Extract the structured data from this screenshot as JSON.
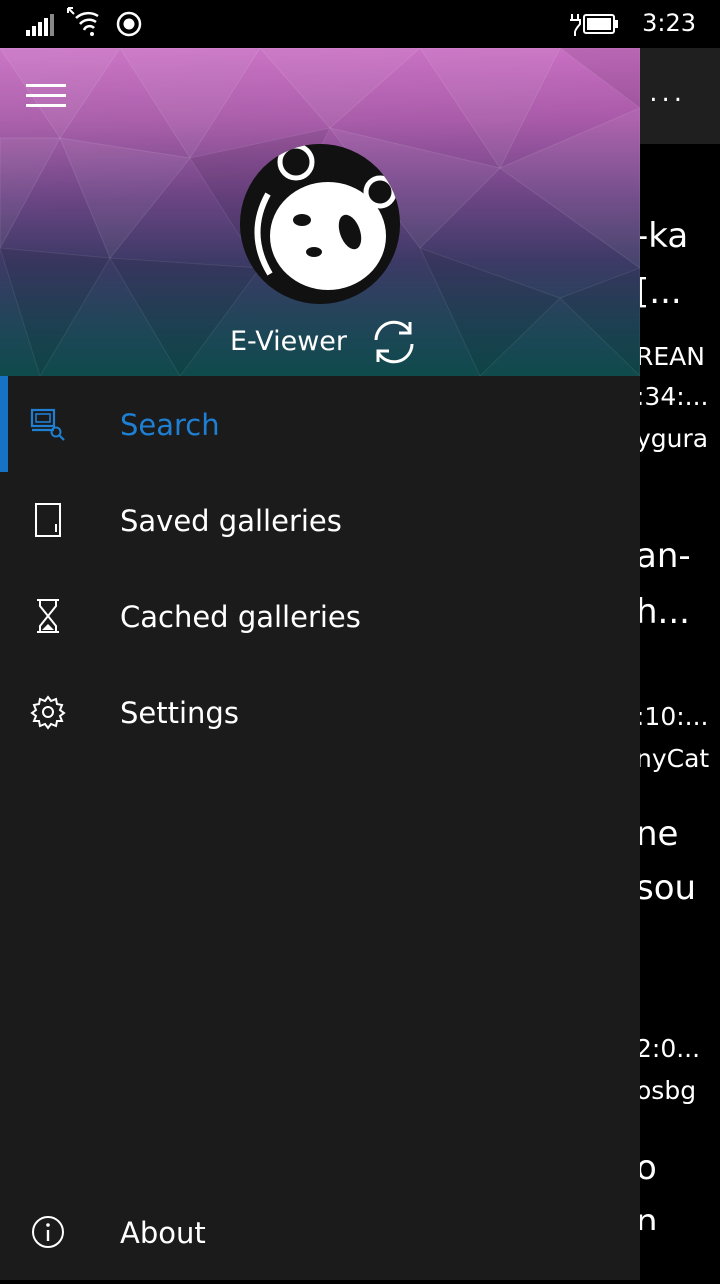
{
  "status_bar": {
    "time": "3:23",
    "icons": [
      "signal-icon",
      "wifi-icon",
      "location-icon",
      "battery-icon"
    ]
  },
  "drawer": {
    "header": {
      "app_name": "E-Viewer",
      "avatar": "panda-avatar",
      "sync_icon": "sync-icon",
      "menu_icon": "hamburger-menu-icon"
    },
    "items": [
      {
        "label": "Search",
        "icon": "search-gallery-icon",
        "selected": true
      },
      {
        "label": "Saved galleries",
        "icon": "saved-icon",
        "selected": false
      },
      {
        "label": "Cached galleries",
        "icon": "hourglass-icon",
        "selected": false
      },
      {
        "label": "Settings",
        "icon": "gear-icon",
        "selected": false
      }
    ],
    "footer_item": {
      "label": "About",
      "icon": "info-icon"
    }
  },
  "background": {
    "more_label": "...",
    "fragments": [
      "-ka",
      "[...",
      "REAN",
      ":34:...",
      "ygura",
      "an-",
      "h...",
      ":10:...",
      "nyCat",
      "ne",
      "sou",
      "2:0...",
      "osbg",
      "o",
      "n"
    ]
  },
  "colors": {
    "accent": "#1673c4",
    "drawer_bg": "#1b1b1b",
    "appbar_bg": "#1f1f1f"
  }
}
